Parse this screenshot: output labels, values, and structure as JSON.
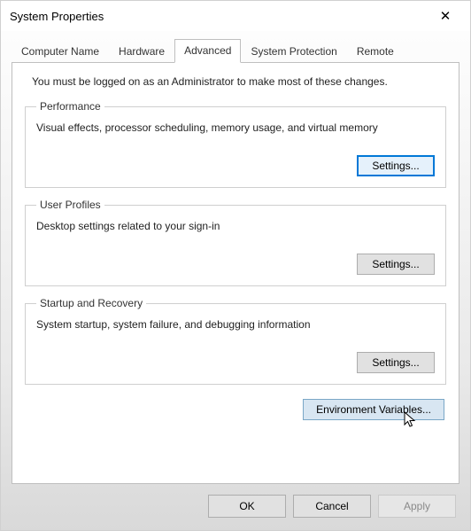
{
  "window": {
    "title": "System Properties"
  },
  "tabs": {
    "computer_name": "Computer Name",
    "hardware": "Hardware",
    "advanced": "Advanced",
    "system_protection": "System Protection",
    "remote": "Remote"
  },
  "advanced": {
    "intro": "You must be logged on as an Administrator to make most of these changes.",
    "performance": {
      "legend": "Performance",
      "desc": "Visual effects, processor scheduling, memory usage, and virtual memory",
      "settings_label": "Settings..."
    },
    "user_profiles": {
      "legend": "User Profiles",
      "desc": "Desktop settings related to your sign-in",
      "settings_label": "Settings..."
    },
    "startup_recovery": {
      "legend": "Startup and Recovery",
      "desc": "System startup, system failure, and debugging information",
      "settings_label": "Settings..."
    },
    "env_vars_label": "Environment Variables..."
  },
  "dialog_buttons": {
    "ok": "OK",
    "cancel": "Cancel",
    "apply": "Apply"
  }
}
